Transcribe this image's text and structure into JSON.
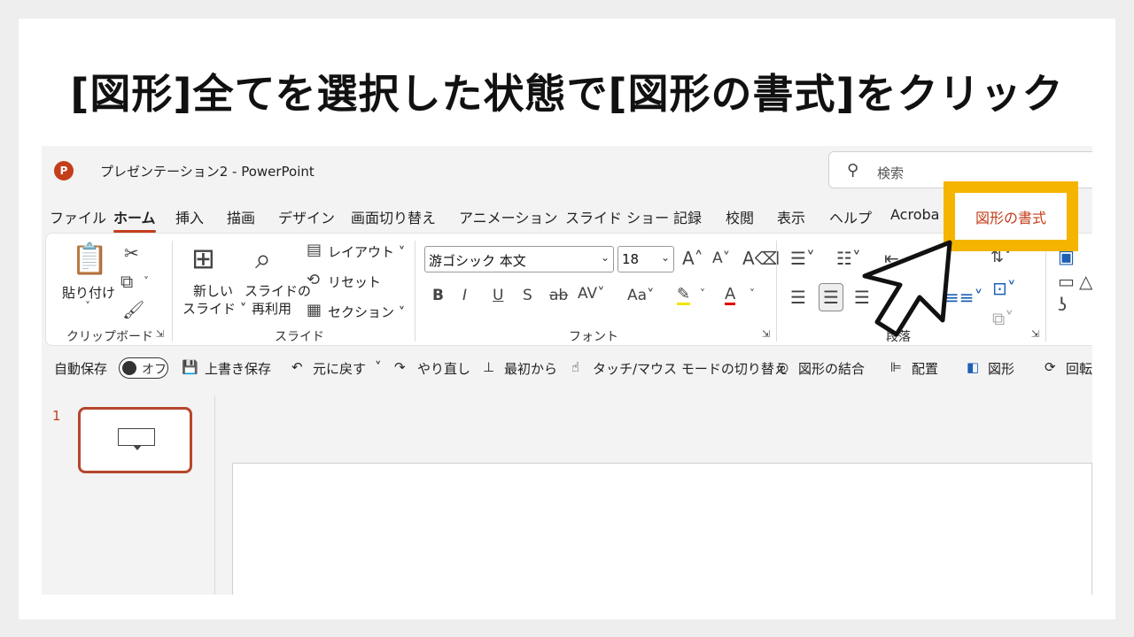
{
  "headline": "[図形]全てを選択した状態で[図形の書式]をクリック",
  "window": {
    "app_logo_letter": "P",
    "title": "プレゼンテーション2  -  PowerPoint",
    "search_placeholder": "検索"
  },
  "tabs": [
    "ファイル",
    "ホーム",
    "挿入",
    "描画",
    "デザイン",
    "画面切り替え",
    "アニメーション",
    "スライド ショー",
    "記録",
    "校閲",
    "表示",
    "ヘルプ",
    "Acroba"
  ],
  "active_tab": "ホーム",
  "highlighted_tab": "図形の書式",
  "ribbon": {
    "clipboard": {
      "paste": "貼り付け",
      "label": "クリップボード"
    },
    "slides": {
      "new_slide_1": "新しい",
      "new_slide_2": "スライド ˅",
      "reuse_1": "スライドの",
      "reuse_2": "再利用",
      "layout": "レイアウト ˅",
      "reset": "リセット",
      "section": "セクション ˅",
      "label": "スライド"
    },
    "font": {
      "name": "游ゴシック 本文",
      "size": "18",
      "label": "フォント"
    },
    "paragraph": {
      "label": "段落"
    }
  },
  "qat": {
    "autosave": "自動保存",
    "autosave_state": "オフ",
    "save": "上書き保存",
    "undo": "元に戻す",
    "redo": "やり直し",
    "from_start": "最初から",
    "touch_mode": "タッチ/マウス モードの切り替え",
    "merge_shapes": "図形の結合",
    "arrange": "配置",
    "shapes": "図形",
    "rotate": "回転"
  },
  "slide_panel": {
    "number": "1"
  },
  "colors": {
    "accent": "#c43e1c",
    "highlight": "#f5b400"
  }
}
